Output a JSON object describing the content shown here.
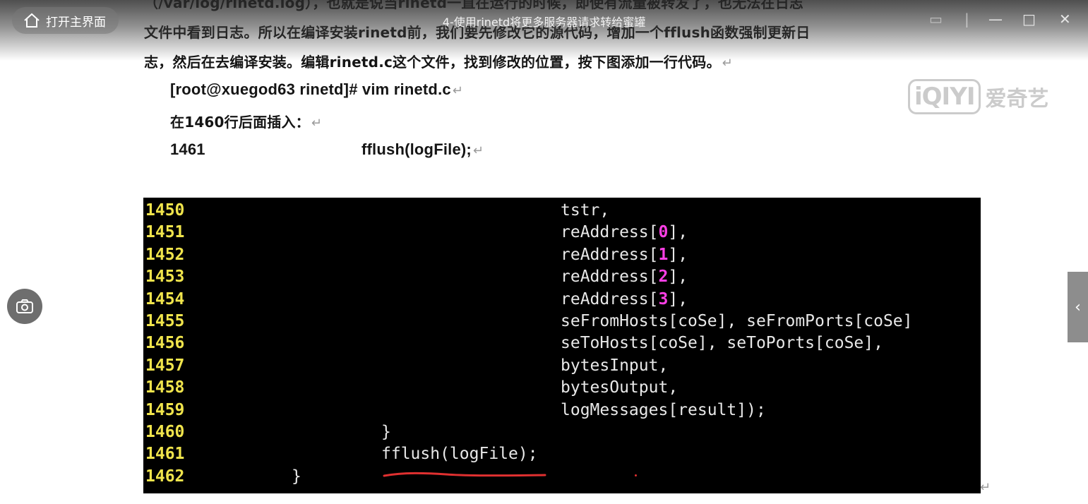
{
  "document": {
    "line_top": "（/var/log/rinetd.log），也就是说当rinetd一直在运行的时候，即使有流量被转发了，也无法在日志",
    "line_1": "文件中看到日志。所以在编译安装rinetd前，我们要先修改它的源代码，增加一个fflush函数强制更新日",
    "line_2": "志，然后在去编译安装。编辑rinetd.c这个文件，找到修改的位置，按下图添加一行代码。",
    "cmd": "[root@xuegod63 rinetd]# vim rinetd.c",
    "insert_note": "在1460行后面插入：",
    "code_line_number": "1461",
    "code_line_text": "fflush(logFile);",
    "return_mark": "↵"
  },
  "player": {
    "home_label": "打开主界面",
    "title": "4-使用rinetd将更多服务器请求转给蜜罐",
    "watermark_logo": "iQIYI",
    "watermark_text": "爱奇艺",
    "collapse_label": "‹"
  },
  "terminal": {
    "lines": [
      {
        "num": "1450",
        "indent": 20,
        "text": "tstr,"
      },
      {
        "num": "1451",
        "indent": 20,
        "pre": "reAddress[",
        "n": "0",
        "post": "],"
      },
      {
        "num": "1452",
        "indent": 20,
        "pre": "reAddress[",
        "n": "1",
        "post": "],"
      },
      {
        "num": "1453",
        "indent": 20,
        "pre": "reAddress[",
        "n": "2",
        "post": "],"
      },
      {
        "num": "1454",
        "indent": 20,
        "pre": "reAddress[",
        "n": "3",
        "post": "],"
      },
      {
        "num": "1455",
        "indent": 20,
        "text": "seFromHosts[coSe], seFromPorts[coSe]"
      },
      {
        "num": "1456",
        "indent": 20,
        "text": "seToHosts[coSe], seToPorts[coSe],"
      },
      {
        "num": "1457",
        "indent": 20,
        "text": "bytesInput,"
      },
      {
        "num": "1458",
        "indent": 20,
        "text": "bytesOutput,"
      },
      {
        "num": "1459",
        "indent": 20,
        "text": "logMessages[result]);"
      },
      {
        "num": "1460",
        "indent": 10,
        "text": "}"
      },
      {
        "num": "1461",
        "indent": 10,
        "text": "fflush(logFile);"
      },
      {
        "num": "1462",
        "indent": 5,
        "text": "}"
      }
    ],
    "colors": {
      "line_number": "#f0e44c",
      "code": "#e8e8e8",
      "digit": "#ff3fe6",
      "underline": "#e03030"
    }
  }
}
